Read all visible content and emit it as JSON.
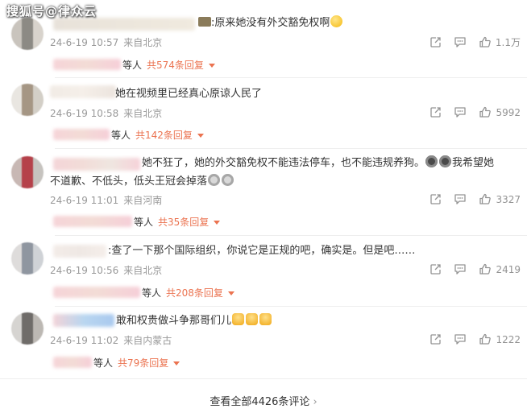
{
  "watermark": "搜狐号@律众云",
  "comments": [
    {
      "text_before": ":原来她没有外交豁免权啊",
      "time": "24-6-19 10:57",
      "location": "来自北京",
      "likes": "1.1万",
      "reply_prefix": "等人",
      "reply_label": "共574条回复"
    },
    {
      "text": "她在视频里已经真心原谅人民了",
      "time": "24-6-19 10:58",
      "location": "来自北京",
      "likes": "5992",
      "reply_prefix": "等人",
      "reply_label": "共142条回复"
    },
    {
      "text_line1_a": "她不狂了，她的外交豁免权不能违法停车，也不能违规养狗。",
      "text_line1_b": "我希望她",
      "text_line2": "不道歉、不低头，低头王冠会掉落",
      "time": "24-6-19 11:01",
      "location": "来自河南",
      "likes": "3327",
      "reply_prefix": "等人",
      "reply_label": "共35条回复"
    },
    {
      "text": ":查了一下那个国际组织，你说它是正规的吧，确实是。但是吧……",
      "time": "24-6-19 10:56",
      "location": "来自北京",
      "likes": "2419",
      "reply_prefix": "等人",
      "reply_label": "共208条回复"
    },
    {
      "text": "敢和权贵做斗争那哥们儿",
      "time": "24-6-19 11:02",
      "location": "来自内蒙古",
      "likes": "1222",
      "reply_prefix": "等人",
      "reply_label": "共79条回复"
    }
  ],
  "footer": {
    "view_all": "查看全部4426条评论"
  },
  "colors": {
    "link": "#eb7350",
    "meta": "#999999",
    "divider": "#eeeeee"
  },
  "icons": [
    "share-icon",
    "comment-icon",
    "like-icon",
    "chevron-right-icon",
    "caret-down-icon"
  ]
}
